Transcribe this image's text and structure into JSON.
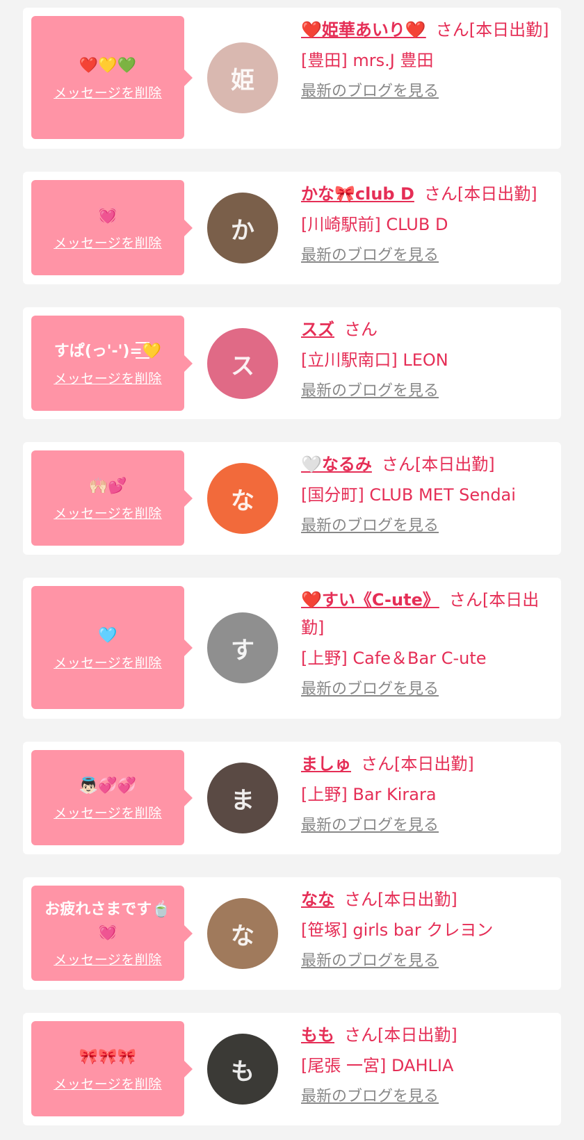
{
  "cards": [
    {
      "message": "❤️💛💚",
      "delete_label": "メッセージを削除",
      "name": "❤️姫華あいり❤️",
      "suffix": "さん[本日出勤]",
      "shop": "[豊田] mrs.J 豊田",
      "blog_link": "最新のブログを見る",
      "avatar_initial": "姫"
    },
    {
      "message": "💓",
      "delete_label": "メッセージを削除",
      "name": "かな🎀club D",
      "suffix": "さん[本日出勤]",
      "shop": "[川崎駅前] CLUB D",
      "blog_link": "最新のブログを見る",
      "avatar_initial": "か"
    },
    {
      "message": "すぱ(っ'-')=͟͟͞͞💛",
      "delete_label": "メッセージを削除",
      "name": "スズ",
      "suffix": "さん",
      "shop": "[立川駅南口] LEON",
      "blog_link": "最新のブログを見る",
      "avatar_initial": "ス"
    },
    {
      "message": "🙌🏻💕",
      "delete_label": "メッセージを削除",
      "name": "🤍なるみ",
      "suffix": "さん[本日出勤]",
      "shop": "[国分町] CLUB MET Sendai",
      "blog_link": "最新のブログを見る",
      "avatar_initial": "な"
    },
    {
      "message": "🩵",
      "delete_label": "メッセージを削除",
      "name": "❤️すい《C-ute》",
      "suffix": "さん[本日出勤]",
      "shop": "[上野] Cafe＆Bar C-ute",
      "blog_link": "最新のブログを見る",
      "avatar_initial": "す"
    },
    {
      "message": "👼🏻💞💞",
      "delete_label": "メッセージを削除",
      "name": "ましゅ",
      "suffix": "さん[本日出勤]",
      "shop": "[上野] Bar Kirara",
      "blog_link": "最新のブログを見る",
      "avatar_initial": "ま"
    },
    {
      "message": "お疲れさまです🍵💓",
      "delete_label": "メッセージを削除",
      "name": "なな",
      "suffix": "さん[本日出勤]",
      "shop": "[笹塚] girls bar クレヨン",
      "blog_link": "最新のブログを見る",
      "avatar_initial": "な"
    },
    {
      "message": "🎀🎀🎀",
      "delete_label": "メッセージを削除",
      "name": "もも",
      "suffix": "さん[本日出勤]",
      "shop": "[尾張 一宮] DAHLIA",
      "blog_link": "最新のブログを見る",
      "avatar_initial": "も"
    }
  ],
  "colors": {
    "bubble": "#ff94a6",
    "accent": "#e52e56",
    "link_gray": "#888888",
    "page_bg": "#f3f3f3"
  }
}
